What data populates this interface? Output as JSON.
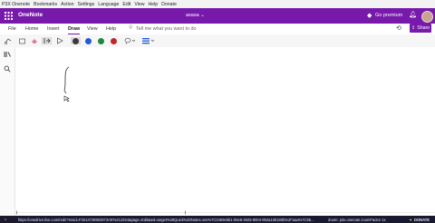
{
  "menubar": {
    "items": [
      "P3X Onenote",
      "Bookmarks",
      "Action",
      "Settings",
      "Language",
      "Edit",
      "View",
      "Help",
      "Donate"
    ]
  },
  "titlebar": {
    "app_name": "OneNote",
    "doc_name": "asasa ⌄",
    "premium_label": "Go premium",
    "accent_color": "#7719aa"
  },
  "tabs": {
    "items": [
      "File",
      "Home",
      "Insert",
      "Draw",
      "View",
      "Help"
    ],
    "active": "Draw",
    "tell_me_placeholder": "Tell me what you want to do",
    "share_label": "Share"
  },
  "ribbon": {
    "pen_colors": [
      "#3a3a3a",
      "#1f5bd6",
      "#1e8a3a",
      "#c0272d"
    ]
  },
  "status": {
    "url": "https://onedrive.live.com/redir?resid=F2613728802973AE%212254&page=Edit&wd=target%28Quick%20Notes.one%7C0469e5b1-06e8-4925-9004-853a105180b%2Faaa%7C95...",
    "zoom": "Zoom: p3x.onenote.zoomFactor 1x",
    "donate": "DONATE"
  }
}
